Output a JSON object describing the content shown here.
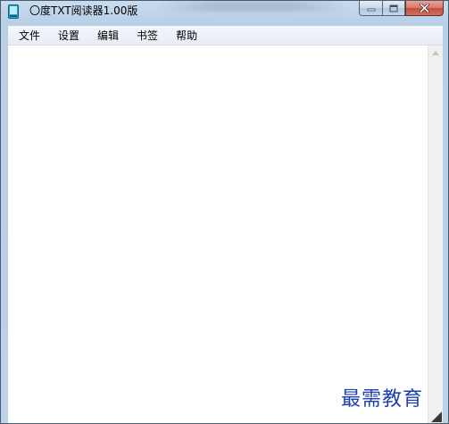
{
  "window": {
    "title": "〇度TXT阅读器1.00版"
  },
  "icons": {
    "app": "text-file-icon",
    "minimize": "minimize-icon",
    "maximize": "maximize-icon",
    "close": "close-icon",
    "scroll_up": "arrow-up-icon",
    "resize": "resize-grip-icon"
  },
  "menubar": {
    "items": [
      "文件",
      "设置",
      "编辑",
      "书签",
      "帮助"
    ]
  },
  "editor": {
    "content": ""
  },
  "watermark": {
    "text": "最需教育"
  },
  "colors": {
    "frame": "#bcd2e8",
    "close_button": "#c24f3f",
    "watermark": "#1d3fb0"
  }
}
